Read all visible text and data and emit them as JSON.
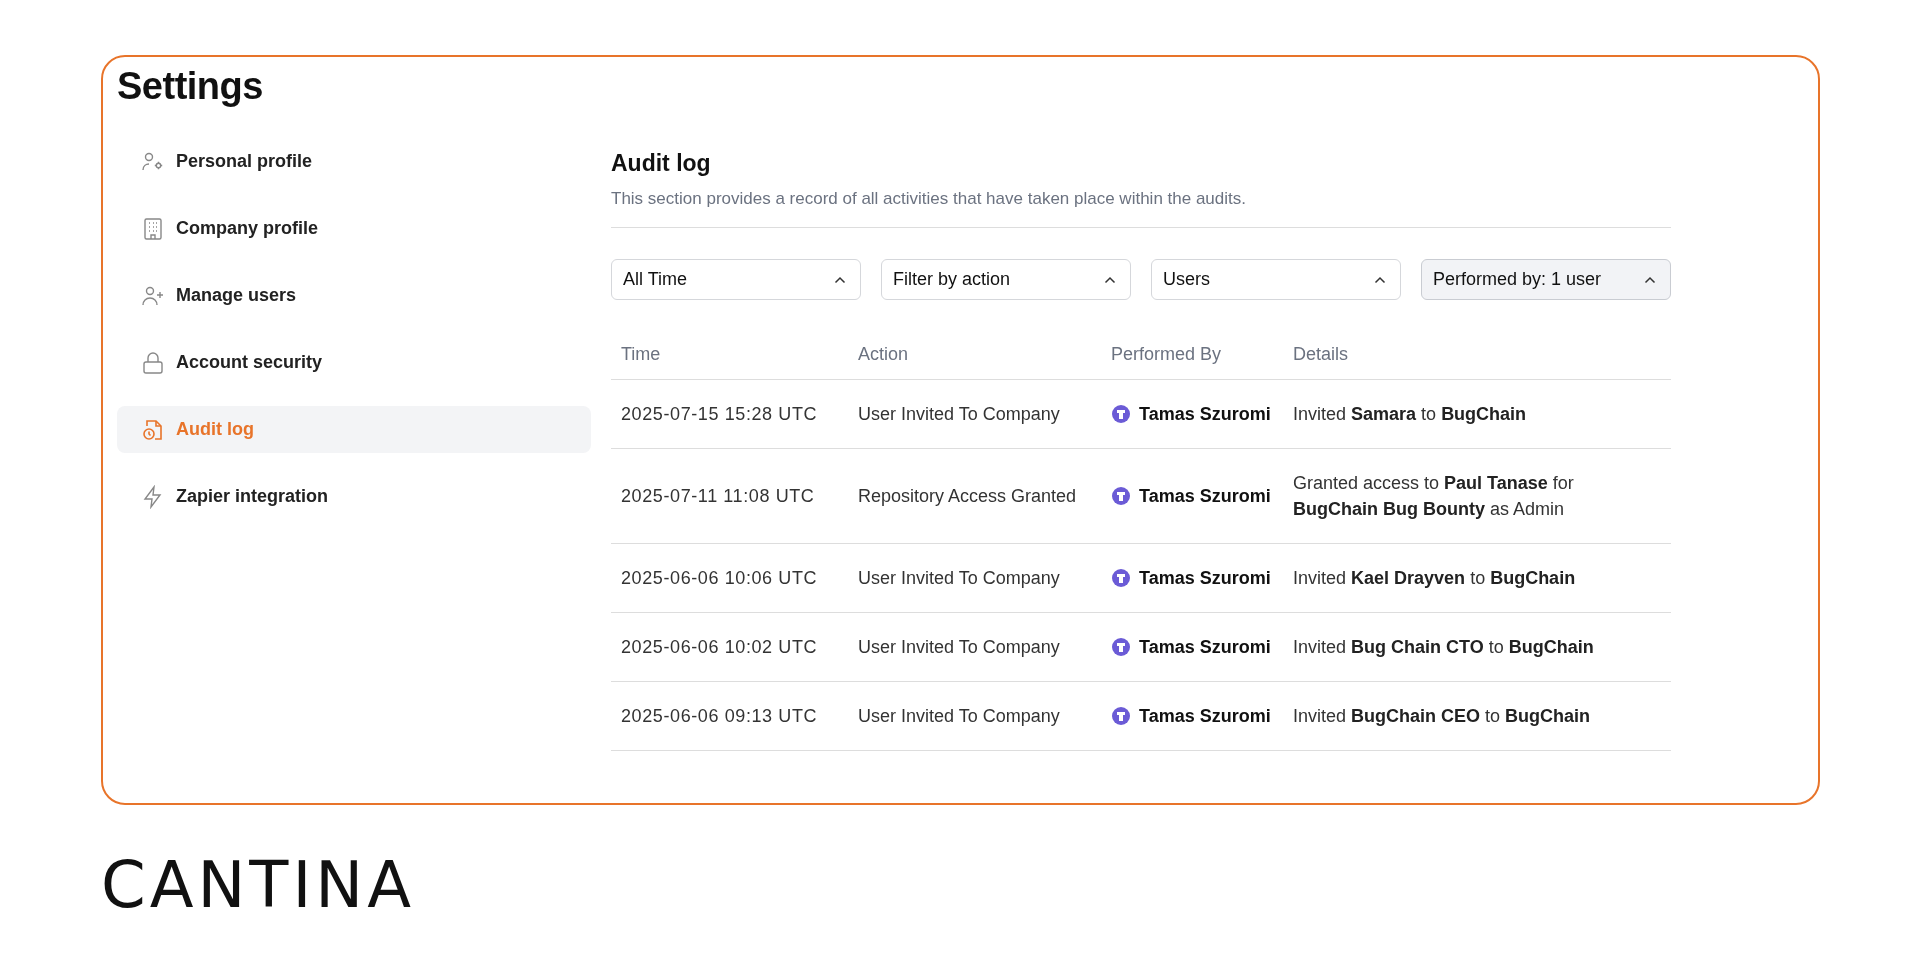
{
  "page": {
    "title": "Settings"
  },
  "sidebar": {
    "items": [
      {
        "label": "Personal profile",
        "selected": false
      },
      {
        "label": "Company profile",
        "selected": false
      },
      {
        "label": "Manage users",
        "selected": false
      },
      {
        "label": "Account security",
        "selected": false
      },
      {
        "label": "Audit log",
        "selected": true
      },
      {
        "label": "Zapier integration",
        "selected": false
      }
    ]
  },
  "section": {
    "title": "Audit log",
    "description": "This section provides a record of all activities that have taken place within the audits."
  },
  "filters": [
    {
      "label": "All Time",
      "active": false
    },
    {
      "label": "Filter by action",
      "active": false
    },
    {
      "label": "Users",
      "active": false
    },
    {
      "label": "Performed by: 1 user",
      "active": true
    }
  ],
  "table": {
    "columns": [
      "Time",
      "Action",
      "Performed By",
      "Details"
    ],
    "rows": [
      {
        "time": "2025-07-15 15:28 UTC",
        "action": "User Invited To Company",
        "performed_by": "Tamas Szuromi",
        "details": "Invited **Samara** to **BugChain**"
      },
      {
        "time": "2025-07-11 11:08 UTC",
        "action": "Repository Access Granted",
        "performed_by": "Tamas Szuromi",
        "details": "Granted access to **Paul Tanase** for **BugChain Bug Bounty** as Admin"
      },
      {
        "time": "2025-06-06 10:06 UTC",
        "action": "User Invited To Company",
        "performed_by": "Tamas Szuromi",
        "details": "Invited **Kael Drayven** to **BugChain**"
      },
      {
        "time": "2025-06-06 10:02 UTC",
        "action": "User Invited To Company",
        "performed_by": "Tamas Szuromi",
        "details": "Invited **Bug Chain CTO** to **BugChain**"
      },
      {
        "time": "2025-06-06 09:13 UTC",
        "action": "User Invited To Company",
        "performed_by": "Tamas Szuromi",
        "details": "Invited **BugChain CEO** to **BugChain**"
      }
    ]
  },
  "brand": {
    "logo": "CANTINA"
  }
}
